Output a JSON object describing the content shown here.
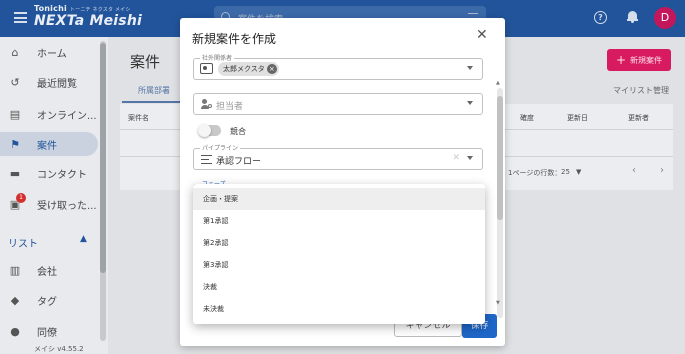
{
  "header": {
    "brand_small": "Tonichi",
    "brand_ruby": "トーニチ ネクスタ メイシ",
    "brand_big": "NEXTa Meishi",
    "search_placeholder": "案件を検索",
    "avatar_initial": "D",
    "avatar_color": "#c2185b",
    "bar_color": "#22549b"
  },
  "sidebar": {
    "items": [
      {
        "label": "ホーム",
        "icon": "home-icon"
      },
      {
        "label": "最近閲覧",
        "icon": "history-icon"
      },
      {
        "label": "オンライン...",
        "icon": "id-card-icon"
      },
      {
        "label": "案件",
        "icon": "flag-icon",
        "active": true
      },
      {
        "label": "コンタクト",
        "icon": "chat-icon"
      },
      {
        "label": "受け取った...",
        "icon": "inbox-icon",
        "badge": "1"
      },
      {
        "label": "会社",
        "icon": "building-icon"
      },
      {
        "label": "タグ",
        "icon": "tag-icon"
      },
      {
        "label": "同僚",
        "icon": "people-icon"
      }
    ],
    "section_list": "リスト",
    "version": "メイシ v4.55.2"
  },
  "main": {
    "title": "案件",
    "new_button": "新規案件",
    "tab_left": "所属部署",
    "tab_right": "マイリスト管理",
    "columns": [
      "案件名",
      "確度",
      "更新日",
      "更新者"
    ],
    "rows_per_page_label": "1ページの行数：",
    "rows_per_page": "25"
  },
  "modal": {
    "title": "新規案件を作成",
    "customer_legend": "社外関係者",
    "customer_chip": "太郎メクスタ",
    "assignee_placeholder": "担当者",
    "toggle_label": "競合",
    "pipeline_legend": "パイプライン",
    "pipeline_value": "承認フロー",
    "phase_legend": "フェーズ",
    "cancel_label": "キャンセル",
    "save_label": "保存"
  },
  "dropdown": {
    "options": [
      "企画・提案",
      "第1承認",
      "第2承認",
      "第3承認",
      "決裁",
      "未決裁"
    ],
    "hovered_index": 0
  }
}
